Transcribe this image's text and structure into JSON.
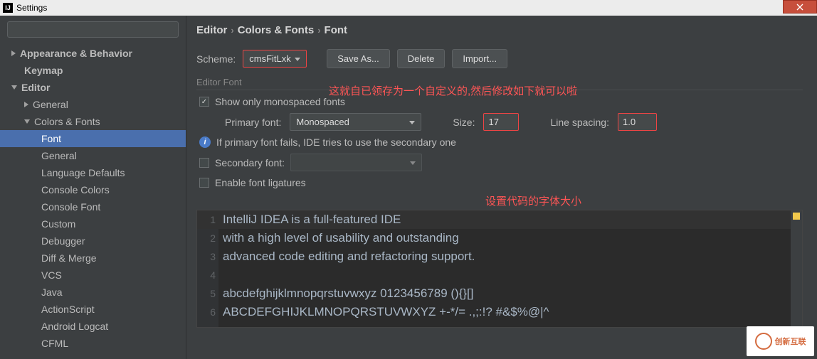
{
  "window": {
    "title": "Settings"
  },
  "search": {
    "placeholder": ""
  },
  "tree": {
    "appearance": "Appearance & Behavior",
    "keymap": "Keymap",
    "editor": "Editor",
    "general": "General",
    "colors_fonts": "Colors & Fonts",
    "items": [
      "Font",
      "General",
      "Language Defaults",
      "Console Colors",
      "Console Font",
      "Custom",
      "Debugger",
      "Diff & Merge",
      "VCS",
      "Java",
      "ActionScript",
      "Android Logcat",
      "CFML"
    ]
  },
  "breadcrumb": {
    "a": "Editor",
    "b": "Colors & Fonts",
    "c": "Font"
  },
  "scheme": {
    "label": "Scheme:",
    "value": "cmsFitLxk",
    "saveas": "Save As...",
    "delete": "Delete",
    "import": "Import..."
  },
  "editor_font": {
    "title": "Editor Font",
    "show_mono": "Show only monospaced fonts",
    "primary_label": "Primary font:",
    "primary_value": "Monospaced",
    "size_label": "Size:",
    "size_value": "17",
    "spacing_label": "Line spacing:",
    "spacing_value": "1.0",
    "fallback_info": "If primary font fails, IDE tries to use the secondary one",
    "secondary_label": "Secondary font:",
    "secondary_value": "",
    "ligatures": "Enable font ligatures"
  },
  "annotations": {
    "line1": "这就自已领存为一个自定义的,然后修改如下就可以啦",
    "line2": "设置代码的字体大小"
  },
  "preview": {
    "lines": [
      "IntelliJ IDEA is a full-featured IDE",
      "with a high level of usability and outstanding",
      "advanced code editing and refactoring support.",
      "",
      "abcdefghijklmnopqrstuvwxyz 0123456789 (){}[]",
      "ABCDEFGHIJKLMNOPQRSTUVWXYZ +-*/= .,;:!? #&$%@|^"
    ]
  },
  "watermark": "创新互联"
}
